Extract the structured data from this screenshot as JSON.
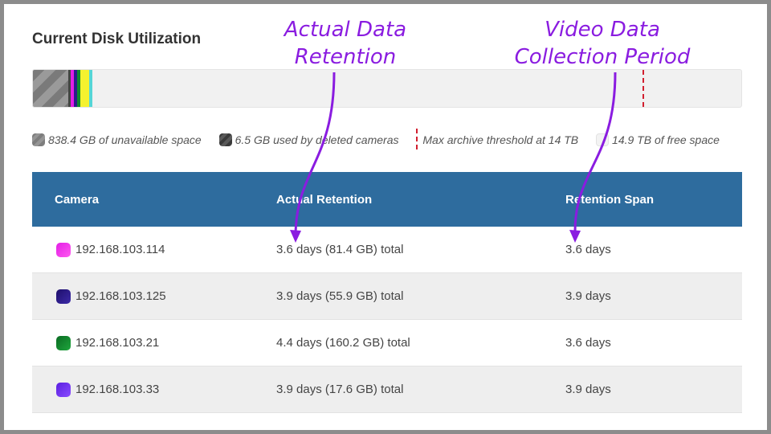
{
  "title": "Current Disk Utilization",
  "annotations": {
    "left_line1": "Actual Data",
    "left_line2": "Retention",
    "right_line1": "Video Data",
    "right_line2": "Collection Period"
  },
  "legend": {
    "unavailable": "838.4 GB of unavailable space",
    "deleted": "6.5 GB used by deleted cameras",
    "threshold": "Max archive threshold at 14 TB",
    "free": "14.9 TB of free space"
  },
  "table": {
    "headers": [
      "Camera",
      "Actual Retention",
      "Retention Span"
    ],
    "rows": [
      {
        "camera": "192.168.103.114",
        "actual": "3.6 days (81.4 GB) total",
        "span": "3.6 days",
        "color": "#e31ee6"
      },
      {
        "camera": "192.168.103.125",
        "actual": "3.9 days (55.9 GB) total",
        "span": "3.9 days",
        "color": "#2d1a8c"
      },
      {
        "camera": "192.168.103.21",
        "actual": "4.4 days (160.2 GB) total",
        "span": "3.6 days",
        "color": "#0d8a2c"
      },
      {
        "camera": "192.168.103.33",
        "actual": "3.9 days (17.6 GB) total",
        "span": "3.9 days",
        "color": "#7b2cff"
      }
    ]
  },
  "colors": {
    "header_bg": "#2e6c9e",
    "annotation": "#8a1ce0",
    "threshold": "#d11f2f"
  }
}
